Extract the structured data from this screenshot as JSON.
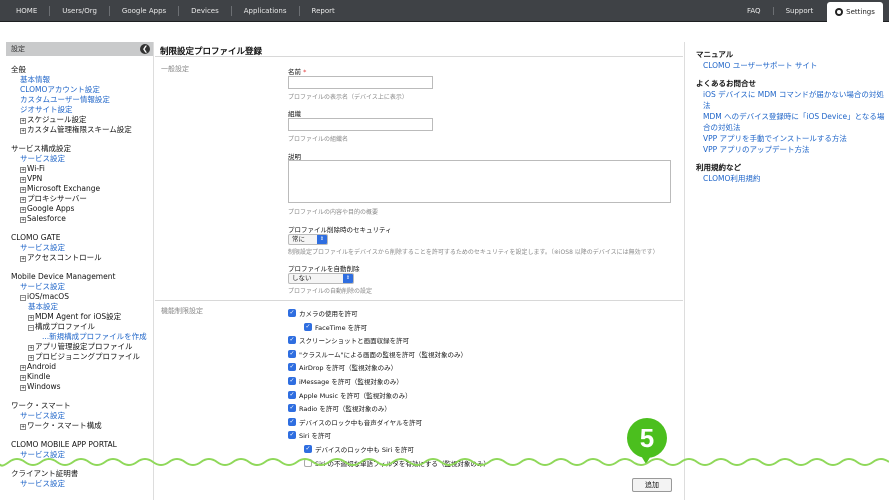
{
  "topnav": {
    "left": [
      "HOME",
      "Users/Org",
      "Google Apps",
      "Devices",
      "Applications",
      "Report"
    ],
    "right": [
      "FAQ",
      "Support"
    ],
    "settings": "Settings"
  },
  "sidebar": {
    "header": "設定",
    "collapse_glyph": "❮",
    "sections": [
      {
        "title": "全般",
        "rows": [
          {
            "text": "基本情報",
            "kind": "link",
            "lvl": 1
          },
          {
            "text": "CLOMOアカウント設定",
            "kind": "link",
            "lvl": 1
          },
          {
            "text": "カスタムユーザー情報設定",
            "kind": "link",
            "lvl": 1
          },
          {
            "text": "ジオサイト設定",
            "kind": "link",
            "lvl": 1
          },
          {
            "text": "スケジュール設定",
            "kind": "item",
            "lvl": 1,
            "exp": "+"
          },
          {
            "text": "カスタム管理権限スキーム設定",
            "kind": "item",
            "lvl": 1,
            "exp": "+"
          }
        ]
      },
      {
        "title": "サービス構成設定",
        "rows": [
          {
            "text": "サービス設定",
            "kind": "link",
            "lvl": 1
          },
          {
            "text": "Wi-Fi",
            "kind": "item",
            "lvl": 1,
            "exp": "+"
          },
          {
            "text": "VPN",
            "kind": "item",
            "lvl": 1,
            "exp": "+"
          },
          {
            "text": "Microsoft Exchange",
            "kind": "item",
            "lvl": 1,
            "exp": "+"
          },
          {
            "text": "プロキシサーバー",
            "kind": "item",
            "lvl": 1,
            "exp": "+"
          },
          {
            "text": "Google Apps",
            "kind": "item",
            "lvl": 1,
            "exp": "+"
          },
          {
            "text": "Salesforce",
            "kind": "item",
            "lvl": 1,
            "exp": "+"
          }
        ]
      },
      {
        "title": "CLOMO GATE",
        "rows": [
          {
            "text": "サービス設定",
            "kind": "link",
            "lvl": 1
          },
          {
            "text": "アクセスコントロール",
            "kind": "item",
            "lvl": 1,
            "exp": "+"
          }
        ]
      },
      {
        "title": "Mobile Device Management",
        "rows": [
          {
            "text": "サービス設定",
            "kind": "link",
            "lvl": 1
          },
          {
            "text": "iOS/macOS",
            "kind": "item",
            "lvl": 1,
            "exp": "−"
          },
          {
            "text": "基本設定",
            "kind": "link",
            "lvl": 2
          },
          {
            "text": "MDM Agent for iOS設定",
            "kind": "item",
            "lvl": 3,
            "exp": "+"
          },
          {
            "text": "構成プロファイル",
            "kind": "item",
            "lvl": 3,
            "exp": "−"
          },
          {
            "text": "...新規構成プロファイルを作成",
            "kind": "link",
            "lvl": 4
          },
          {
            "text": "アプリ管理設定プロファイル",
            "kind": "item",
            "lvl": 3,
            "exp": "+"
          },
          {
            "text": "プロビジョニングプロファイル",
            "kind": "item",
            "lvl": 3,
            "exp": "+"
          },
          {
            "text": "Android",
            "kind": "item",
            "lvl": 1,
            "exp": "+"
          },
          {
            "text": "Kindle",
            "kind": "item",
            "lvl": 1,
            "exp": "+"
          },
          {
            "text": "Windows",
            "kind": "item",
            "lvl": 1,
            "exp": "+"
          }
        ]
      },
      {
        "title": "ワーク・スマート",
        "rows": [
          {
            "text": "サービス設定",
            "kind": "link",
            "lvl": 1
          },
          {
            "text": "ワーク・スマート構成",
            "kind": "item",
            "lvl": 1,
            "exp": "+"
          }
        ]
      },
      {
        "title": "CLOMO MOBILE APP PORTAL",
        "rows": [
          {
            "text": "サービス設定",
            "kind": "link",
            "lvl": 1
          }
        ]
      },
      {
        "title": "クライアント証明書",
        "rows": [
          {
            "text": "サービス設定",
            "kind": "link",
            "lvl": 1
          }
        ]
      }
    ]
  },
  "main": {
    "page_title": "制限設定プロファイル登録",
    "general_section": "一般設定",
    "name_label": "名前",
    "name_required": "*",
    "name_hint": "プロファイルの表示名（デバイス上に表示）",
    "org_label": "組織",
    "org_hint": "プロファイルの組織名",
    "desc_label": "説明",
    "desc_hint": "プロファイルの内容や目的の概要",
    "security_label": "プロファイル削除時のセキュリティ",
    "security_value": "常に",
    "security_hint": "制限設定プロファイルをデバイスから削除することを許可するためのセキュリティを設定します。（※iOS8 以降のデバイスには無効です）",
    "autodelete_label": "プロファイルを自動削除",
    "autodelete_value": "しない",
    "autodelete_hint": "プロファイルの自動削除の設定",
    "restrict_section": "機能制限設定",
    "checkboxes": [
      {
        "label": "カメラの使用を許可",
        "checked": true,
        "indent": 0
      },
      {
        "label": "FaceTime を許可",
        "checked": true,
        "indent": 1
      },
      {
        "label": "スクリーンショットと画面収録を許可",
        "checked": true,
        "indent": 0
      },
      {
        "label": "\"クラスルーム\"による画面の監視を許可（監視対象のみ）",
        "checked": true,
        "indent": 0
      },
      {
        "label": "AirDrop を許可（監視対象のみ）",
        "checked": true,
        "indent": 0
      },
      {
        "label": "iMessage を許可（監視対象のみ）",
        "checked": true,
        "indent": 0
      },
      {
        "label": "Apple Music を許可（監視対象のみ）",
        "checked": true,
        "indent": 0
      },
      {
        "label": "Radio を許可（監視対象のみ）",
        "checked": true,
        "indent": 0
      },
      {
        "label": "デバイスのロック中も音声ダイヤルを許可",
        "checked": true,
        "indent": 0
      },
      {
        "label": "Siri を許可",
        "checked": true,
        "indent": 0
      },
      {
        "label": "デバイスのロック中も Siri を許可",
        "checked": true,
        "indent": 1
      },
      {
        "label": "Siri の不適切な単語フィルタを有効にする（監視対象のみ）",
        "checked": false,
        "indent": 1
      }
    ],
    "add_button": "追加",
    "callout_number": "5"
  },
  "right": {
    "manual_heading": "マニュアル",
    "manual_links": [
      "CLOMO ユーザーサポート サイト"
    ],
    "faq_heading": "よくあるお問合せ",
    "faq_links": [
      "iOS デバイスに MDM コマンドが届かない場合の対処法",
      "MDM へのデバイス登録時に「iOS Device」となる場合の対処法",
      "VPP アプリを手動でインストールする方法",
      "VPP アプリのアップデート方法"
    ],
    "terms_heading": "利用規約など",
    "terms_links": [
      "CLOMO利用規約"
    ]
  },
  "colors": {
    "topbar": "#3f4246",
    "link": "#1e64c8",
    "checkbox": "#2f6ee0",
    "callout": "#4bbf1e"
  }
}
